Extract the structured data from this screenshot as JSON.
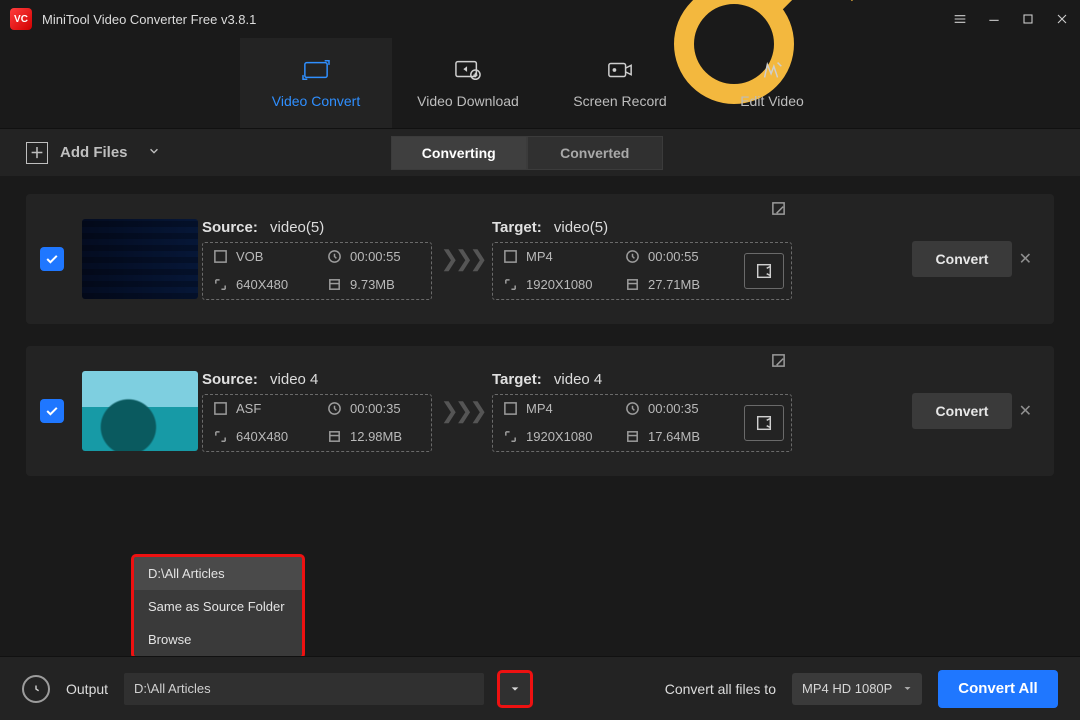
{
  "app": {
    "title": "MiniTool Video Converter Free v3.8.1"
  },
  "tabs": {
    "convert": "Video Convert",
    "download": "Video Download",
    "record": "Screen Record",
    "edit": "Edit Video"
  },
  "toolbar": {
    "add_files": "Add Files",
    "seg_converting": "Converting",
    "seg_converted": "Converted"
  },
  "labels": {
    "source": "Source:",
    "target": "Target:",
    "convert": "Convert",
    "output": "Output",
    "convert_all_to": "Convert all files to",
    "convert_all": "Convert All"
  },
  "tasks": [
    {
      "src_name": "video(5)",
      "src_fmt": "VOB",
      "src_dur": "00:00:55",
      "src_res": "640X480",
      "src_size": "9.73MB",
      "tgt_name": "video(5)",
      "tgt_fmt": "MP4",
      "tgt_dur": "00:00:55",
      "tgt_res": "1920X1080",
      "tgt_size": "27.71MB"
    },
    {
      "src_name": "video 4",
      "src_fmt": "ASF",
      "src_dur": "00:00:35",
      "src_res": "640X480",
      "src_size": "12.98MB",
      "tgt_name": "video 4",
      "tgt_fmt": "MP4",
      "tgt_dur": "00:00:35",
      "tgt_res": "1920X1080",
      "tgt_size": "17.64MB"
    }
  ],
  "output": {
    "path": "D:\\All Articles",
    "preset": "MP4 HD 1080P",
    "menu": {
      "opt1": "D:\\All Articles",
      "opt2": "Same as Source Folder",
      "opt3": "Browse"
    }
  }
}
